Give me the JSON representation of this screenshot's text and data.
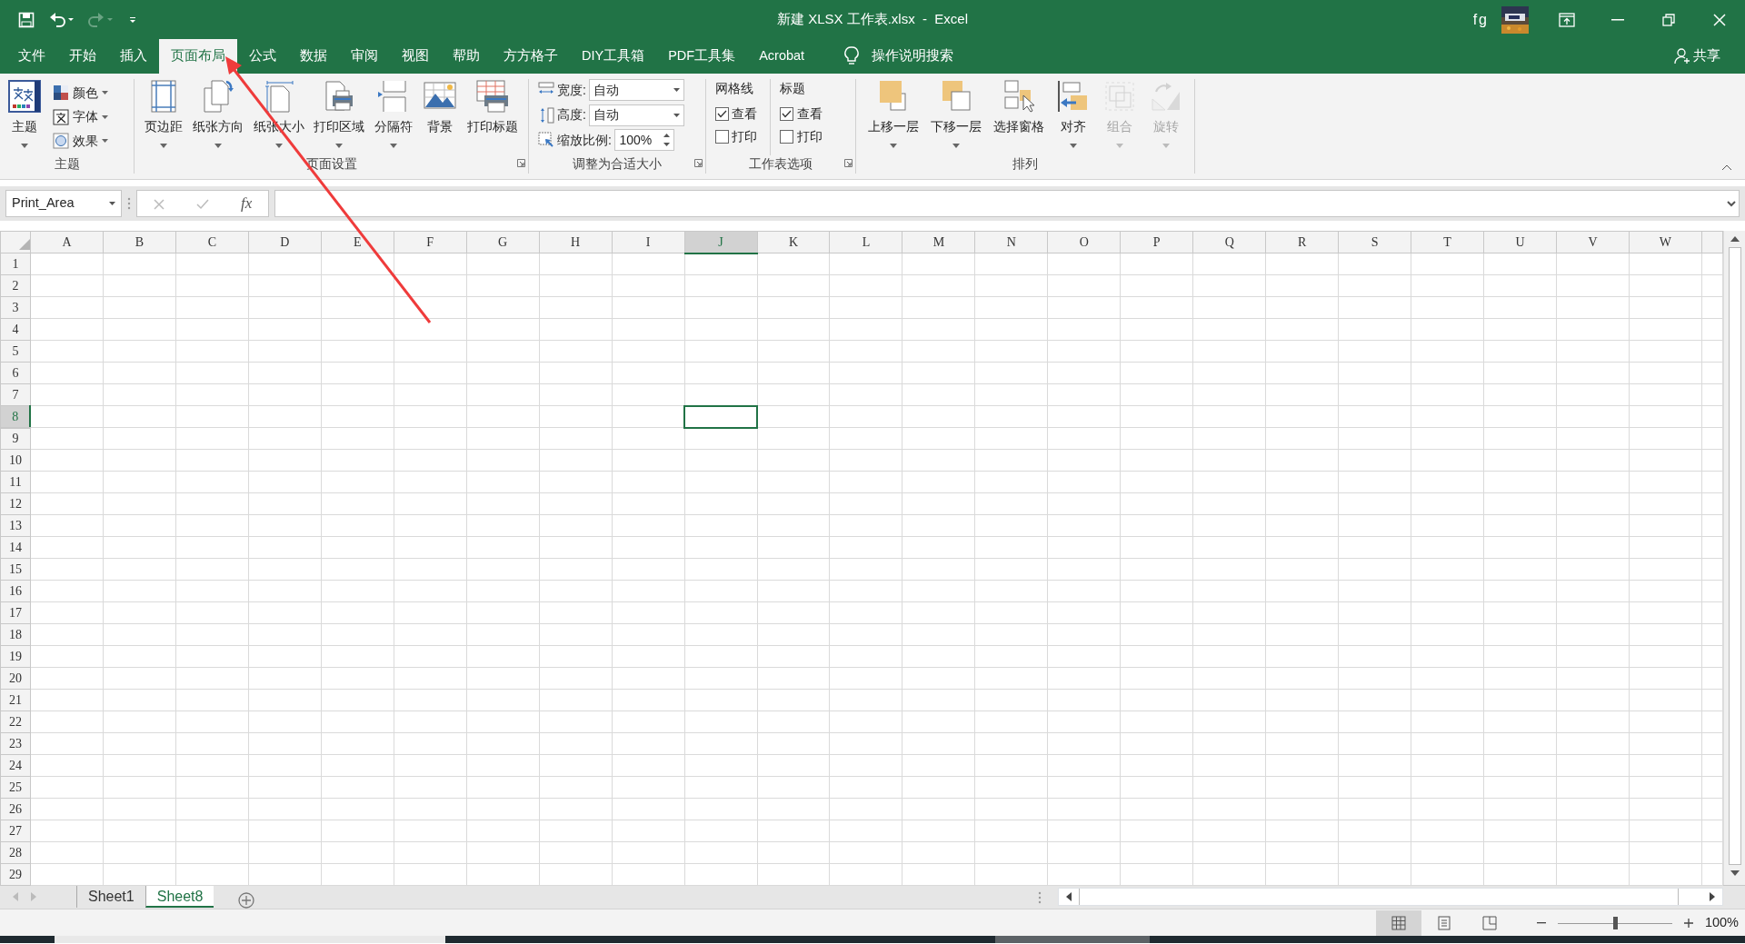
{
  "window": {
    "title": "新建 XLSX 工作表.xlsx  -  Excel",
    "user_initials": "fg"
  },
  "ribbon_tabs": [
    {
      "label": "文件",
      "selected": false
    },
    {
      "label": "开始",
      "selected": false
    },
    {
      "label": "插入",
      "selected": false
    },
    {
      "label": "页面布局",
      "selected": true
    },
    {
      "label": "公式",
      "selected": false
    },
    {
      "label": "数据",
      "selected": false
    },
    {
      "label": "审阅",
      "selected": false
    },
    {
      "label": "视图",
      "selected": false
    },
    {
      "label": "帮助",
      "selected": false
    },
    {
      "label": "方方格子",
      "selected": false
    },
    {
      "label": "DIY工具箱",
      "selected": false
    },
    {
      "label": "PDF工具集",
      "selected": false
    },
    {
      "label": "Acrobat",
      "selected": false
    }
  ],
  "tell_me": "操作说明搜索",
  "share": "共享",
  "ribbon_groups": [
    {
      "title": "主题",
      "kind": "themes",
      "buttons": [
        {
          "label": "主题",
          "dropdown": true,
          "disabled": false
        }
      ],
      "small_buttons": [
        {
          "label": "颜色",
          "dropdown": true
        },
        {
          "label": "字体",
          "dropdown": true
        },
        {
          "label": "效果",
          "dropdown": true
        }
      ]
    },
    {
      "title": "页面设置",
      "launcher": true,
      "kind": "buttons",
      "buttons": [
        {
          "label": "页边距",
          "dropdown": true,
          "disabled": false
        },
        {
          "label": "纸张方向",
          "dropdown": true,
          "disabled": false
        },
        {
          "label": "纸张大小",
          "dropdown": true,
          "disabled": false
        },
        {
          "label": "打印区域",
          "dropdown": true,
          "disabled": false
        },
        {
          "label": "分隔符",
          "dropdown": true,
          "disabled": false
        },
        {
          "label": "背景",
          "dropdown": false,
          "disabled": false
        },
        {
          "label": "打印标题",
          "dropdown": false,
          "disabled": false
        }
      ]
    },
    {
      "title": "调整为合适大小",
      "launcher": true,
      "kind": "fields",
      "fields": [
        {
          "label": "宽度:",
          "value": "自动",
          "kind": "dropdown"
        },
        {
          "label": "高度:",
          "value": "自动",
          "kind": "dropdown"
        },
        {
          "label": "缩放比例:",
          "value": "100%",
          "kind": "spinner"
        }
      ]
    },
    {
      "title": "工作表选项",
      "launcher": true,
      "kind": "options",
      "options": [
        {
          "heading": "网格线",
          "view": {
            "label": "查看",
            "checked": true
          },
          "print": {
            "label": "打印",
            "checked": false
          }
        },
        {
          "heading": "标题",
          "view": {
            "label": "查看",
            "checked": true
          },
          "print": {
            "label": "打印",
            "checked": false
          }
        }
      ]
    },
    {
      "title": "排列",
      "kind": "buttons",
      "buttons": [
        {
          "label": "上移一层",
          "dropdown": true,
          "disabled": false
        },
        {
          "label": "下移一层",
          "dropdown": true,
          "disabled": false
        },
        {
          "label": "选择窗格",
          "dropdown": false,
          "disabled": false
        },
        {
          "label": "对齐",
          "dropdown": true,
          "disabled": false
        },
        {
          "label": "组合",
          "dropdown": true,
          "disabled": true
        },
        {
          "label": "旋转",
          "dropdown": true,
          "disabled": true
        }
      ]
    }
  ],
  "name_box": "Print_Area",
  "formula_bar": {
    "fx": "fx"
  },
  "columns": [
    {
      "label": "A",
      "selected": false
    },
    {
      "label": "B",
      "selected": false
    },
    {
      "label": "C",
      "selected": false
    },
    {
      "label": "D",
      "selected": false
    },
    {
      "label": "E",
      "selected": false
    },
    {
      "label": "F",
      "selected": false
    },
    {
      "label": "G",
      "selected": false
    },
    {
      "label": "H",
      "selected": false
    },
    {
      "label": "I",
      "selected": false
    },
    {
      "label": "J",
      "selected": true
    },
    {
      "label": "K",
      "selected": false
    },
    {
      "label": "L",
      "selected": false
    },
    {
      "label": "M",
      "selected": false
    },
    {
      "label": "N",
      "selected": false
    },
    {
      "label": "O",
      "selected": false
    },
    {
      "label": "P",
      "selected": false
    },
    {
      "label": "Q",
      "selected": false
    },
    {
      "label": "R",
      "selected": false
    },
    {
      "label": "S",
      "selected": false
    },
    {
      "label": "T",
      "selected": false
    },
    {
      "label": "U",
      "selected": false
    },
    {
      "label": "V",
      "selected": false
    },
    {
      "label": "W",
      "selected": false
    }
  ],
  "rows": [
    {
      "label": "1",
      "selected": false
    },
    {
      "label": "2",
      "selected": false
    },
    {
      "label": "3",
      "selected": false
    },
    {
      "label": "4",
      "selected": false
    },
    {
      "label": "5",
      "selected": false
    },
    {
      "label": "6",
      "selected": false
    },
    {
      "label": "7",
      "selected": false
    },
    {
      "label": "8",
      "selected": true
    },
    {
      "label": "9",
      "selected": false
    },
    {
      "label": "10",
      "selected": false
    },
    {
      "label": "11",
      "selected": false
    },
    {
      "label": "12",
      "selected": false
    },
    {
      "label": "13",
      "selected": false
    },
    {
      "label": "14",
      "selected": false
    },
    {
      "label": "15",
      "selected": false
    },
    {
      "label": "16",
      "selected": false
    },
    {
      "label": "17",
      "selected": false
    },
    {
      "label": "18",
      "selected": false
    },
    {
      "label": "19",
      "selected": false
    },
    {
      "label": "20",
      "selected": false
    },
    {
      "label": "21",
      "selected": false
    },
    {
      "label": "22",
      "selected": false
    },
    {
      "label": "23",
      "selected": false
    },
    {
      "label": "24",
      "selected": false
    },
    {
      "label": "25",
      "selected": false
    },
    {
      "label": "26",
      "selected": false
    },
    {
      "label": "27",
      "selected": false
    },
    {
      "label": "28",
      "selected": false
    },
    {
      "label": "29",
      "selected": false
    }
  ],
  "sheets": [
    {
      "label": "Sheet1",
      "selected": false
    },
    {
      "label": "Sheet8",
      "selected": true
    }
  ],
  "status_bar": {
    "views": [
      {
        "kind": "normal",
        "selected": true
      },
      {
        "kind": "page_layout",
        "selected": false
      },
      {
        "kind": "page_break",
        "selected": false
      }
    ],
    "zoom": {
      "level": 0.5
    },
    "zoom_label": "100%"
  }
}
